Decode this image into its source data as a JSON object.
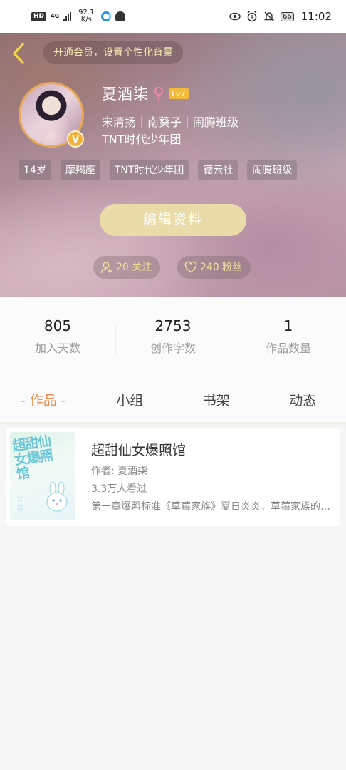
{
  "status_bar": {
    "hd": "HD",
    "network": "4G",
    "speed_value": "92.1",
    "speed_unit": "K/s",
    "battery": "66",
    "time": "11:02"
  },
  "header": {
    "vip_banner": "开通会员，设置个性化背景",
    "avatar_badge": "V",
    "name": "夏酒柒",
    "gender_symbol": "♀",
    "level": "Lv7",
    "bio_line1": "宋清扬｜南葵子｜闹腾班级",
    "bio_line2": "TNT时代少年团",
    "tags": [
      "14岁",
      "摩羯座",
      "TNT时代少年团",
      "德云社",
      "闹腾班级"
    ],
    "edit_button": "编辑资料",
    "following": "20 关注",
    "followers": "240 粉丝"
  },
  "stats": [
    {
      "value": "805",
      "label": "加入天数"
    },
    {
      "value": "2753",
      "label": "创作字数"
    },
    {
      "value": "1",
      "label": "作品数量"
    }
  ],
  "tabs": [
    "- 作品 -",
    "小组",
    "书架",
    "动态"
  ],
  "active_tab": 0,
  "work": {
    "cover_title": "超甜仙女爆照馆",
    "cover_side_text": "CUTE",
    "title": "超甜仙女爆照馆",
    "author": "作者: 夏酒柒",
    "views": "3.3万人看过",
    "excerpt": "第一章爆照标准《草莓家族》夏日炎炎，草莓家族的成员们"
  },
  "colors": {
    "accent": "#e8884a",
    "gold_text": "#f0de9a",
    "level_badge": "#f0b93a",
    "edit_button": "#e9dca9"
  }
}
